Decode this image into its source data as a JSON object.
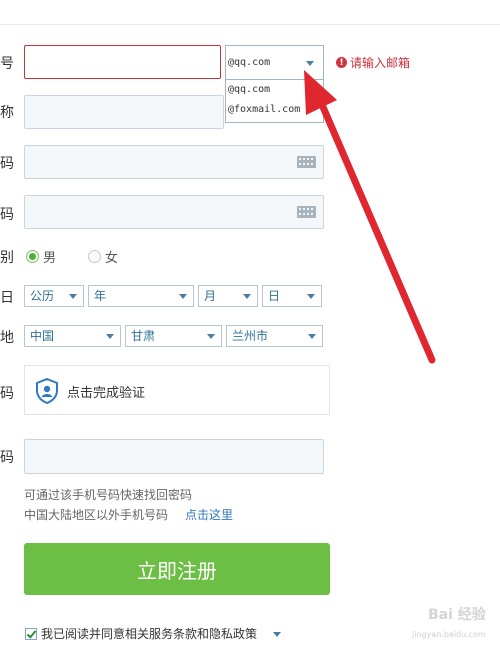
{
  "labels": {
    "account": "号",
    "nickname": "称",
    "password": "码",
    "confirm_password": "码",
    "gender": "别",
    "birthday": "日",
    "location": "地",
    "verify": "码",
    "phone": "码"
  },
  "email": {
    "domain_selected": "@qq.com",
    "options": [
      "@qq.com",
      "@foxmail.com"
    ],
    "error_message": "请输入邮箱"
  },
  "gender": {
    "male": "男",
    "female": "女"
  },
  "birthday": {
    "calendar": "公历",
    "year": "年",
    "month": "月",
    "day": "日"
  },
  "location": {
    "country": "中国",
    "province": "甘肃",
    "city": "兰州市"
  },
  "verification": {
    "text": "点击完成验证"
  },
  "phone": {
    "hint": "可通过该手机号码快速找回密码",
    "overseas_hint": "中国大陆地区以外手机号码",
    "overseas_link": "点击这里"
  },
  "register_button": "立即注册",
  "agreement": "我已阅读并同意相关服务条款和隐私政策",
  "watermark": {
    "logo": "Bai 经验",
    "url": "jingyan.baidu.com"
  },
  "colors": {
    "accent_green": "#6cbe45",
    "error_red": "#c8323c",
    "arrow_red": "#e0262e",
    "link_blue": "#2f79c2"
  }
}
